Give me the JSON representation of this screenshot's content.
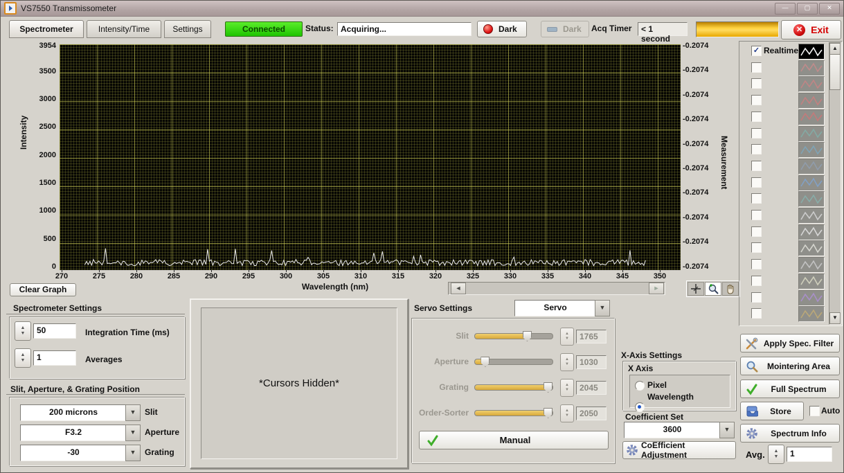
{
  "window": {
    "title": "VS7550 Transmissometer",
    "minimize": "—",
    "maximize": "▢",
    "close": "✕"
  },
  "toolbar": {
    "tabs": [
      {
        "label": "Spectrometer",
        "active": true
      },
      {
        "label": "Intensity/Time",
        "active": false
      },
      {
        "label": "Settings",
        "active": false
      }
    ],
    "connected_label": "Connected",
    "status_label": "Status:",
    "status_value": "Acquiring...",
    "dark_button_label": "Dark",
    "dark_button_disabled_label": "Dark",
    "acq_timer_label": "Acq Timer",
    "acq_timer_value": "< 1 second",
    "exit_label": "Exit",
    "colors": {
      "connected_green": "#2fd500",
      "progress_amber": "#ffc62e",
      "exit_red": "#d40000"
    }
  },
  "graph": {
    "y_label": "Intensity",
    "y_max": 3954,
    "y_ticks": [
      "3954",
      "3500",
      "3000",
      "2500",
      "2000",
      "1500",
      "1000",
      "500",
      "0"
    ],
    "x_label": "Wavelength (nm)",
    "x_ticks": [
      "270",
      "275",
      "280",
      "285",
      "290",
      "295",
      "300",
      "305",
      "310",
      "315",
      "320",
      "325",
      "330",
      "335",
      "340",
      "345",
      "350"
    ],
    "right_label": "Measurement",
    "right_ticks": [
      "-0.2074",
      "-0.2074",
      "-0.2074",
      "-0.2074",
      "-0.2074",
      "-0.2074",
      "-0.2074",
      "-0.2074",
      "-0.2074",
      "-0.2074"
    ],
    "clear_button_label": "Clear Graph",
    "trace": {
      "color": "#ebebeb",
      "baseline_intensity": 90,
      "noise_amplitude": 26,
      "x_start_nm": 273,
      "x_end_nm": 348
    }
  },
  "legend": {
    "rows": [
      {
        "label": "Realtime",
        "checked": true,
        "stroke": "#f5f5f5",
        "bg": "#000000"
      },
      {
        "checked": false,
        "stroke": "#c08b8b",
        "bg": "#8f8f8a"
      },
      {
        "checked": false,
        "stroke": "#c08585",
        "bg": "#8f8f8a"
      },
      {
        "checked": false,
        "stroke": "#c48080",
        "bg": "#8f8f8a"
      },
      {
        "checked": false,
        "stroke": "#c47a7a",
        "bg": "#8f8f8a"
      },
      {
        "checked": false,
        "stroke": "#83aaa4",
        "bg": "#8f8f8a"
      },
      {
        "checked": false,
        "stroke": "#7fa3b5",
        "bg": "#8f8f8a"
      },
      {
        "checked": false,
        "stroke": "#909cab",
        "bg": "#8f8f8a"
      },
      {
        "checked": false,
        "stroke": "#82a0c4",
        "bg": "#8f8f8a"
      },
      {
        "checked": false,
        "stroke": "#88aca8",
        "bg": "#8f8f8a"
      },
      {
        "checked": false,
        "stroke": "#cccccc",
        "bg": "#8f8f8a"
      },
      {
        "checked": false,
        "stroke": "#d6d6d6",
        "bg": "#8f8f8a"
      },
      {
        "checked": false,
        "stroke": "#d6d6cf",
        "bg": "#8f8f8a"
      },
      {
        "checked": false,
        "stroke": "#c2c2c2",
        "bg": "#8f8f8a"
      },
      {
        "checked": false,
        "stroke": "#cfcfbc",
        "bg": "#8f8f8a"
      },
      {
        "checked": false,
        "stroke": "#a98fc9",
        "bg": "#8f8f8a"
      },
      {
        "checked": false,
        "stroke": "#bba878",
        "bg": "#8f8f8a"
      }
    ]
  },
  "spectrometer_settings": {
    "title": "Spectrometer Settings",
    "integration_time": {
      "value": "50",
      "label": "Integration  Time (ms)"
    },
    "averages": {
      "value": "1",
      "label": "Averages"
    },
    "position_title": "Slit, Aperture, & Grating Position",
    "dropdowns": [
      {
        "value": "200 microns",
        "label": "Slit"
      },
      {
        "value": "F3.2",
        "label": "Aperture"
      },
      {
        "value": "-30",
        "label": "Grating"
      }
    ]
  },
  "cursors_panel": {
    "message": "*Cursors Hidden*"
  },
  "servo_settings": {
    "title": "Servo Settings",
    "mode_value": "Servo",
    "sliders": [
      {
        "label": "Slit",
        "value": "1765",
        "fraction": 0.66
      },
      {
        "label": "Aperture",
        "value": "1030",
        "fraction": 0.12
      },
      {
        "label": "Grating",
        "value": "2045",
        "fraction": 0.93
      },
      {
        "label": "Order-Sorter",
        "value": "2050",
        "fraction": 0.93
      }
    ],
    "manual_button_label": "Manual"
  },
  "x_axis_settings": {
    "title": "X-Axis Settings",
    "group_label": "X Axis",
    "radios": [
      {
        "label": "Pixel",
        "selected": false
      },
      {
        "label": "Wavelength",
        "selected": true
      }
    ],
    "coefficient_label": "Coefficient Set",
    "coefficient_value": "3600",
    "adjust_button_label": "CoEfficient Adjustment"
  },
  "action_buttons": {
    "apply_filter": "Apply Spec. Filter",
    "mointering": "Mointering Area",
    "full_spectrum": "Full Spectrum",
    "store": "Store",
    "auto": "Auto",
    "spectrum_info": "Spectrum Info",
    "avg_label": "Avg.",
    "avg_value": "1"
  }
}
